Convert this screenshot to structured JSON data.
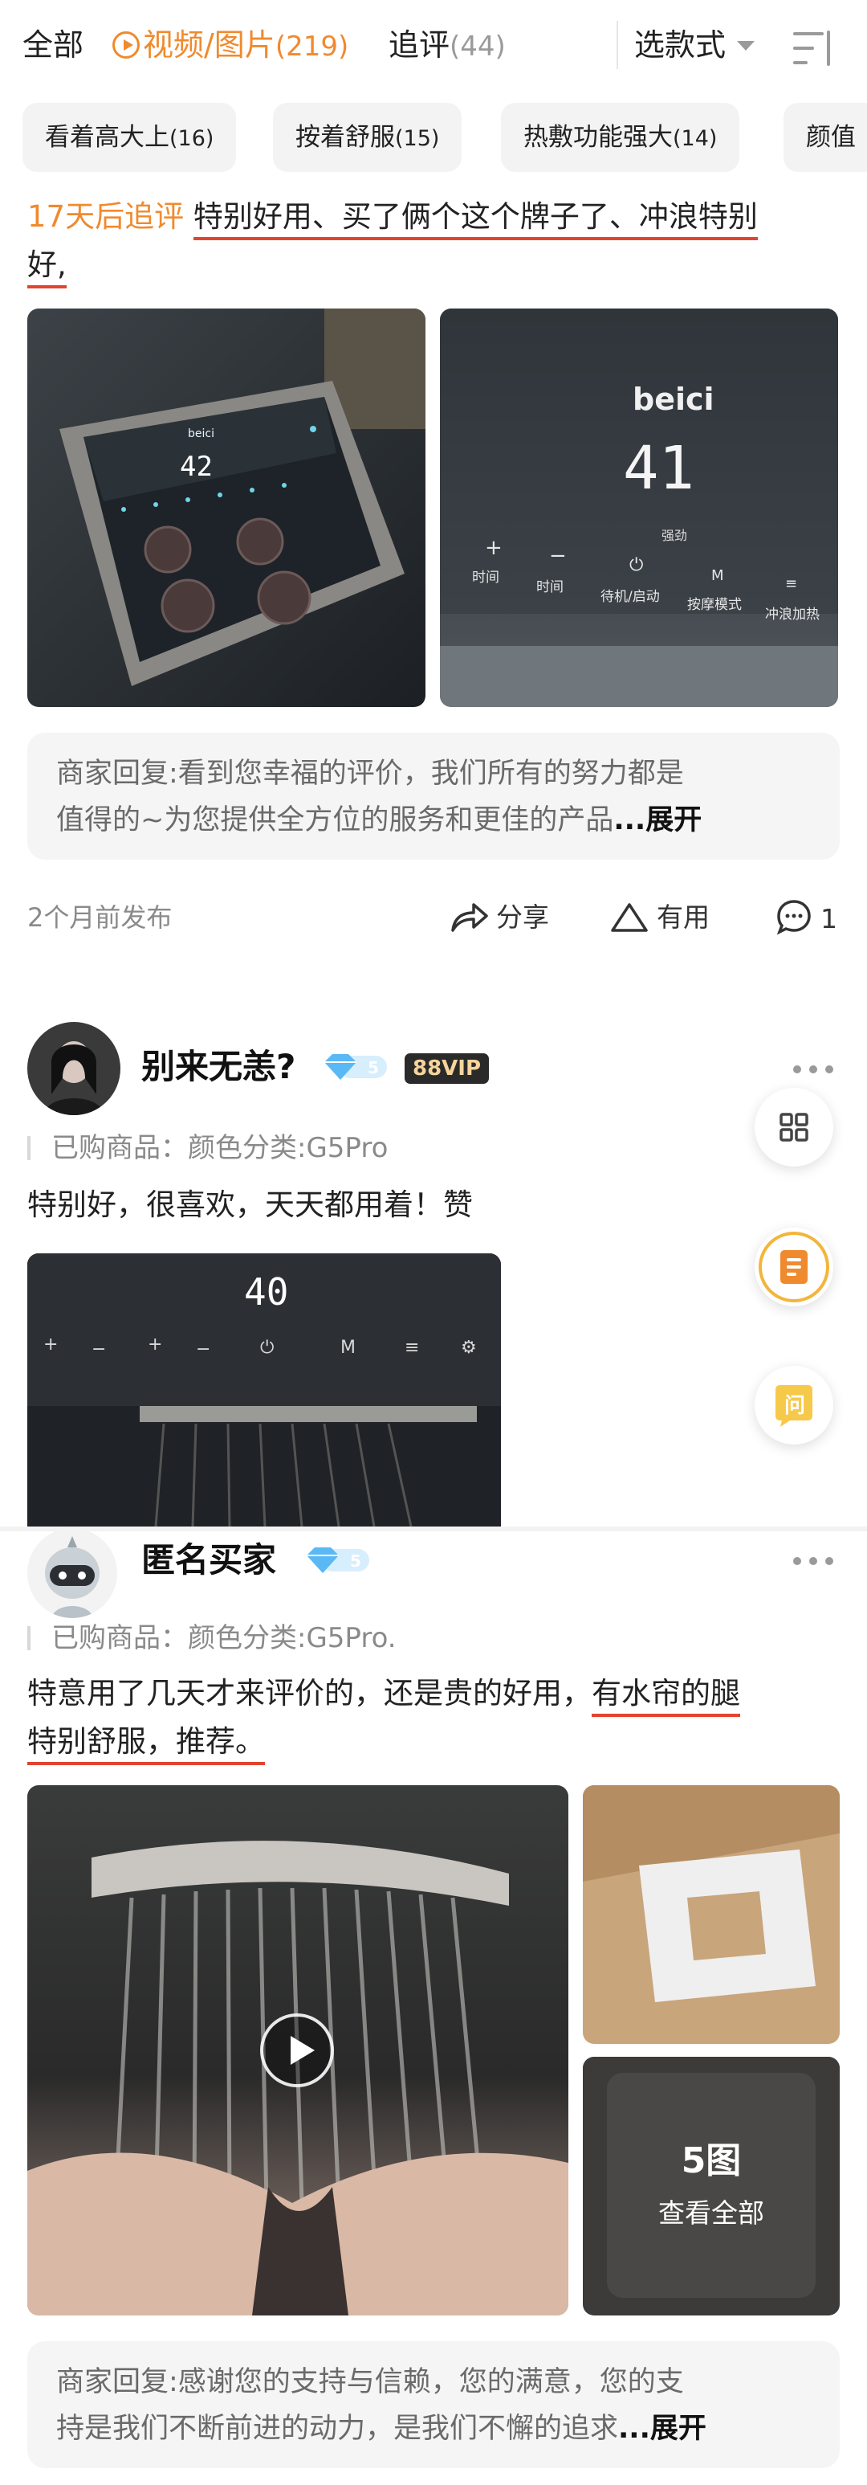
{
  "filter_bar": {
    "tab_all": "全部",
    "tab_media": "视频/图片",
    "tab_media_count": "(219)",
    "tab_followup": "追评",
    "tab_followup_count": "(44)",
    "style_select": "选款式"
  },
  "tags": [
    {
      "label": "看着高大上",
      "count": "(16)"
    },
    {
      "label": "按着舒服",
      "count": "(15)"
    },
    {
      "label": "热敷功能强大",
      "count": "(14)"
    },
    {
      "label": "颜值",
      "count": ""
    }
  ],
  "review1": {
    "followup_label": "17天后追评",
    "text_line1": "特别好用、买了俩个这个牌子了、冲浪特别",
    "text_line2": "好,",
    "photo1_display": "42",
    "photo2_brand": "beici",
    "photo2_display": "41",
    "photo2_sub": "强劲",
    "photo2_controls": [
      "时间",
      "时间",
      "待机/启动",
      "按摩模式",
      "冲浪加热"
    ],
    "reply_line1": "商家回复:看到您幸福的评价，我们所有的努力都是",
    "reply_line2": "值得的~为您提供全方位的服务和更佳的产品",
    "reply_more": "...展开",
    "time": "2个月前发布",
    "share": "分享",
    "useful": "有用",
    "comments": "1"
  },
  "review2": {
    "username": "别来无恙?",
    "level": "5",
    "vip": "88VIP",
    "purchased": "已购商品：颜色分类:G5Pro",
    "text": "特别好，很喜欢，天天都用着！赞",
    "photo_display": "40"
  },
  "review3": {
    "username": "匿名买家",
    "level": "5",
    "purchased": "已购商品：颜色分类:G5Pro.",
    "text_line1_plain": "特意用了几天才来评价的，还是贵的好用，",
    "text_line1_ul": "有水帘的腿",
    "text_line2": "特别舒服，推荐。",
    "more_count": "5图",
    "more_label": "查看全部",
    "reply_line1": "商家回复:感谢您的支持与信赖，您的满意，您的支",
    "reply_line2": "持是我们不断前进的动力，是我们不懈的追求",
    "reply_more": "...展开"
  },
  "fabs": {
    "ask": "问"
  },
  "colors": {
    "accent": "#f08a2e",
    "underline": "#e2442f",
    "diamond": "#5ab8f5"
  }
}
